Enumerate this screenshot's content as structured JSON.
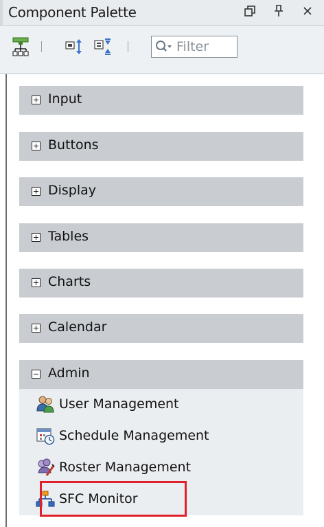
{
  "panel": {
    "title": "Component Palette"
  },
  "toolbar": {
    "filter_placeholder": "Filter"
  },
  "categories": [
    {
      "label": "Input",
      "expanded": false
    },
    {
      "label": "Buttons",
      "expanded": false
    },
    {
      "label": "Display",
      "expanded": false
    },
    {
      "label": "Tables",
      "expanded": false
    },
    {
      "label": "Charts",
      "expanded": false
    },
    {
      "label": "Calendar",
      "expanded": false
    },
    {
      "label": "Admin",
      "expanded": true
    }
  ],
  "admin_items": [
    {
      "label": "User Management",
      "icon": "user-management-icon"
    },
    {
      "label": "Schedule Management",
      "icon": "schedule-management-icon"
    },
    {
      "label": "Roster Management",
      "icon": "roster-management-icon"
    },
    {
      "label": "SFC Monitor",
      "icon": "sfc-monitor-icon"
    }
  ],
  "colors": {
    "category_header": "#c9cdd1",
    "highlight": "#e0202a"
  }
}
